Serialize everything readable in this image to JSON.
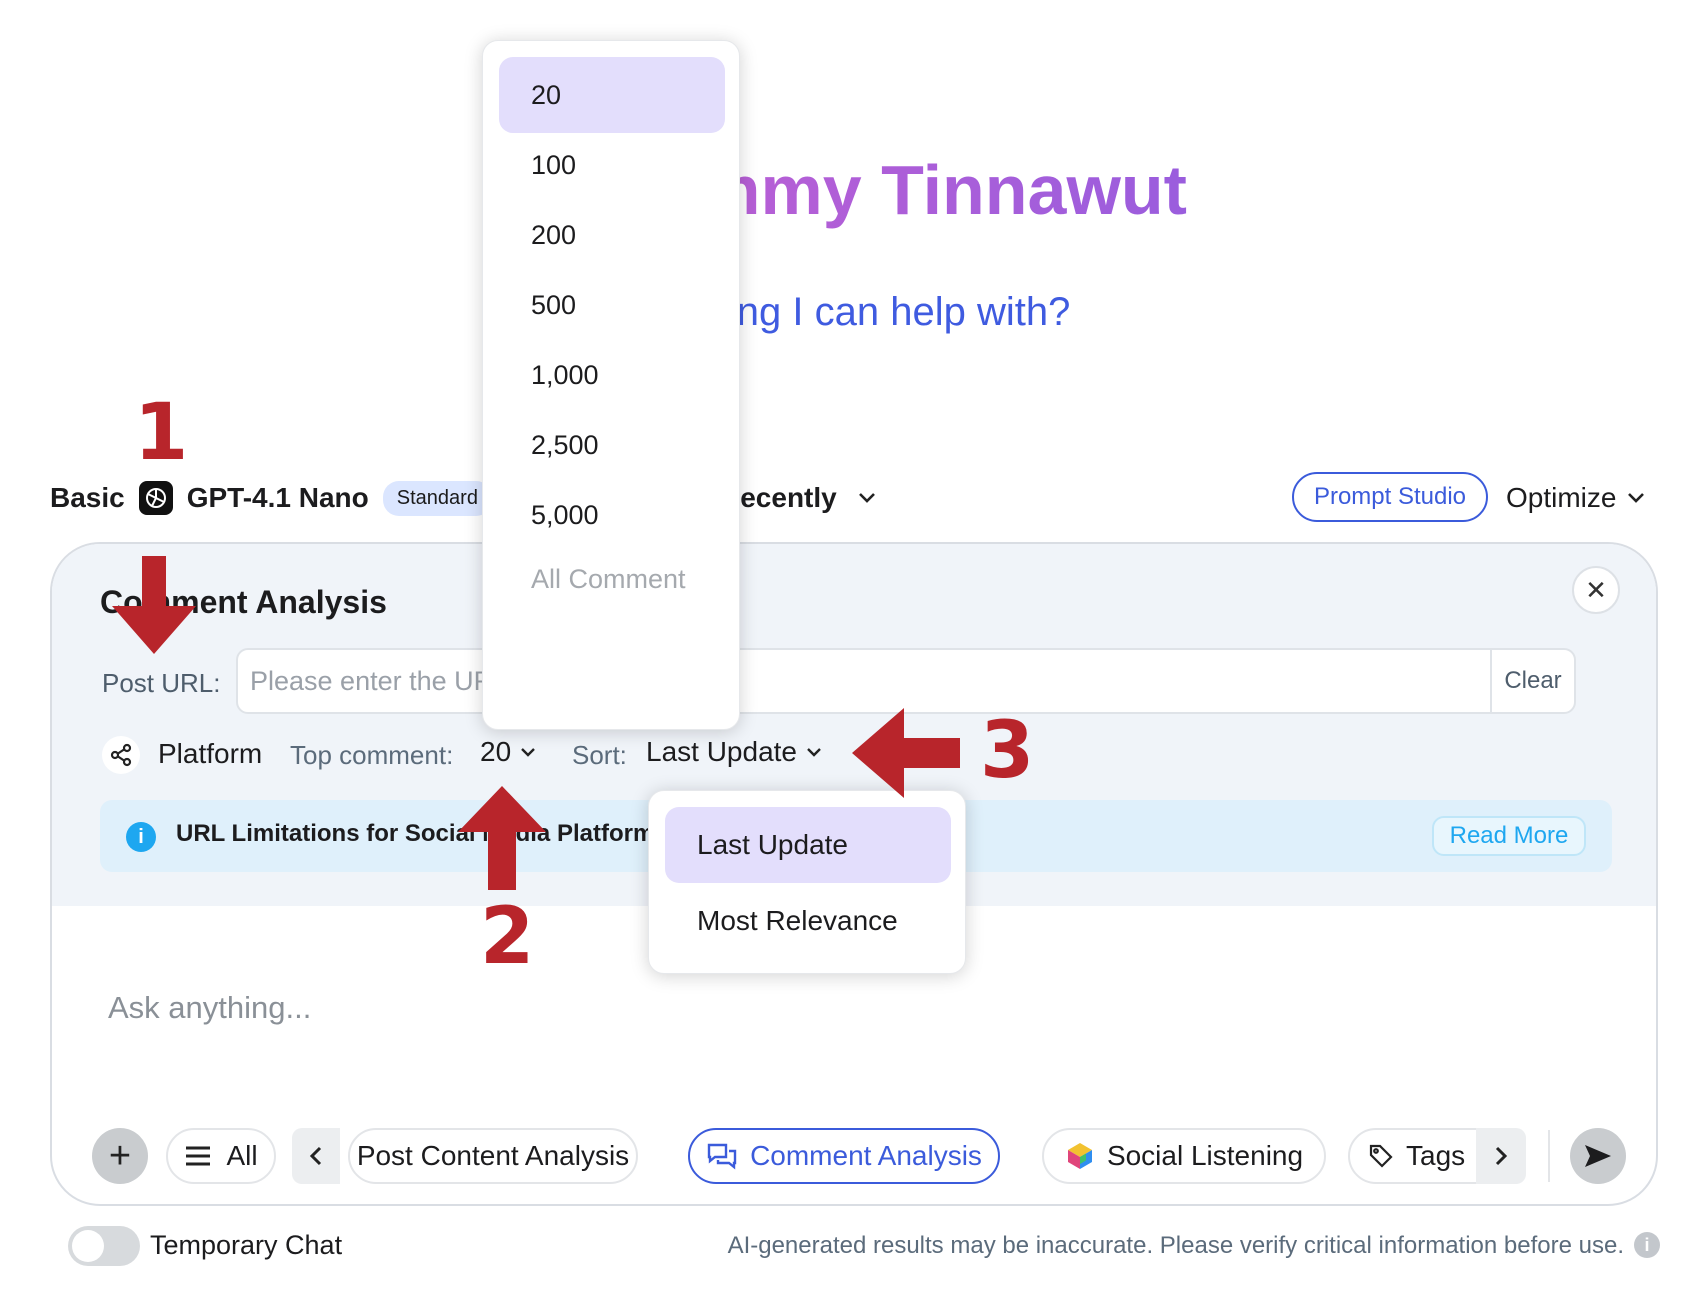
{
  "greeting": {
    "title": "Hi, Tommy Tinnawut",
    "subtitle": "Anything I can help with?"
  },
  "model_bar": {
    "tier": "Basic",
    "model": "GPT-4.1 Nano",
    "badge": "Standard",
    "recent_label": "Recently",
    "prompt_studio": "Prompt Studio",
    "optimize": "Optimize"
  },
  "panel": {
    "title": "Comment Analysis",
    "post_url_label": "Post URL:",
    "url_placeholder": "Please enter the URL of the post",
    "clear": "Clear",
    "platform": "Platform",
    "top_comment_label": "Top comment:",
    "top_comment_value": "20",
    "sort_label": "Sort:",
    "sort_value": "Last Update",
    "info_text": "URL Limitations for Social Media Platforms",
    "read_more": "Read More",
    "ask_placeholder": "Ask anything..."
  },
  "toolbar": {
    "all": "All",
    "chips": [
      "Post Content Analysis",
      "Comment Analysis",
      "Social Listening",
      "Tags"
    ]
  },
  "footer": {
    "temporary_chat": "Temporary Chat",
    "disclaimer": "AI-generated results may be inaccurate. Please verify critical information before use."
  },
  "count_dropdown": {
    "options": [
      "20",
      "100",
      "200",
      "500",
      "1,000",
      "2,500",
      "5,000",
      "All Comment"
    ],
    "selected": "20"
  },
  "sort_dropdown": {
    "options": [
      "Last Update",
      "Most Relevance"
    ],
    "selected": "Last Update"
  },
  "annotations": [
    "1",
    "2",
    "3"
  ],
  "colors": {
    "accent": "#3b5bdb",
    "annotation": "#b8252b",
    "selected_option": "#e3defc",
    "info_bg": "#dff0fb"
  }
}
